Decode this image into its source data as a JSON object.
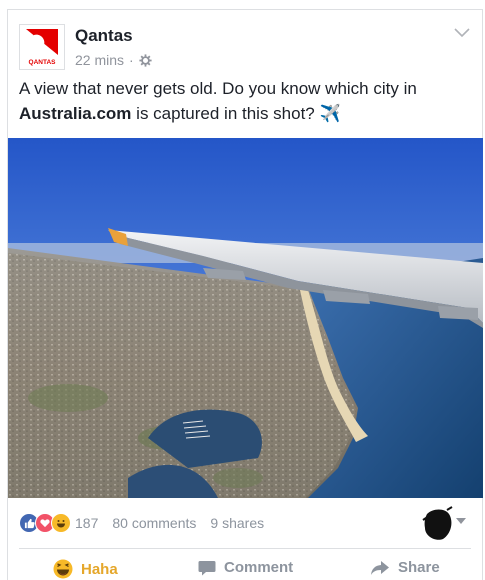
{
  "post": {
    "page_name": "Qantas",
    "time": "22 mins",
    "separator": "·",
    "logo_text": "QANTAS",
    "text_line1": "A view that never gets old. Do you know which city in",
    "text_bold": "Australia.com",
    "text_line2_rest": " is captured in this shot? ✈️"
  },
  "footer": {
    "reaction_count": "187",
    "comments": "80 comments",
    "shares": "9 shares"
  },
  "actions": {
    "haha": "Haha",
    "comment": "Comment",
    "share": "Share"
  },
  "colors": {
    "brand_red": "#e40000",
    "like_blue": "#4267b2",
    "love_red": "#f25268",
    "haha_yellow": "#f7b928"
  }
}
